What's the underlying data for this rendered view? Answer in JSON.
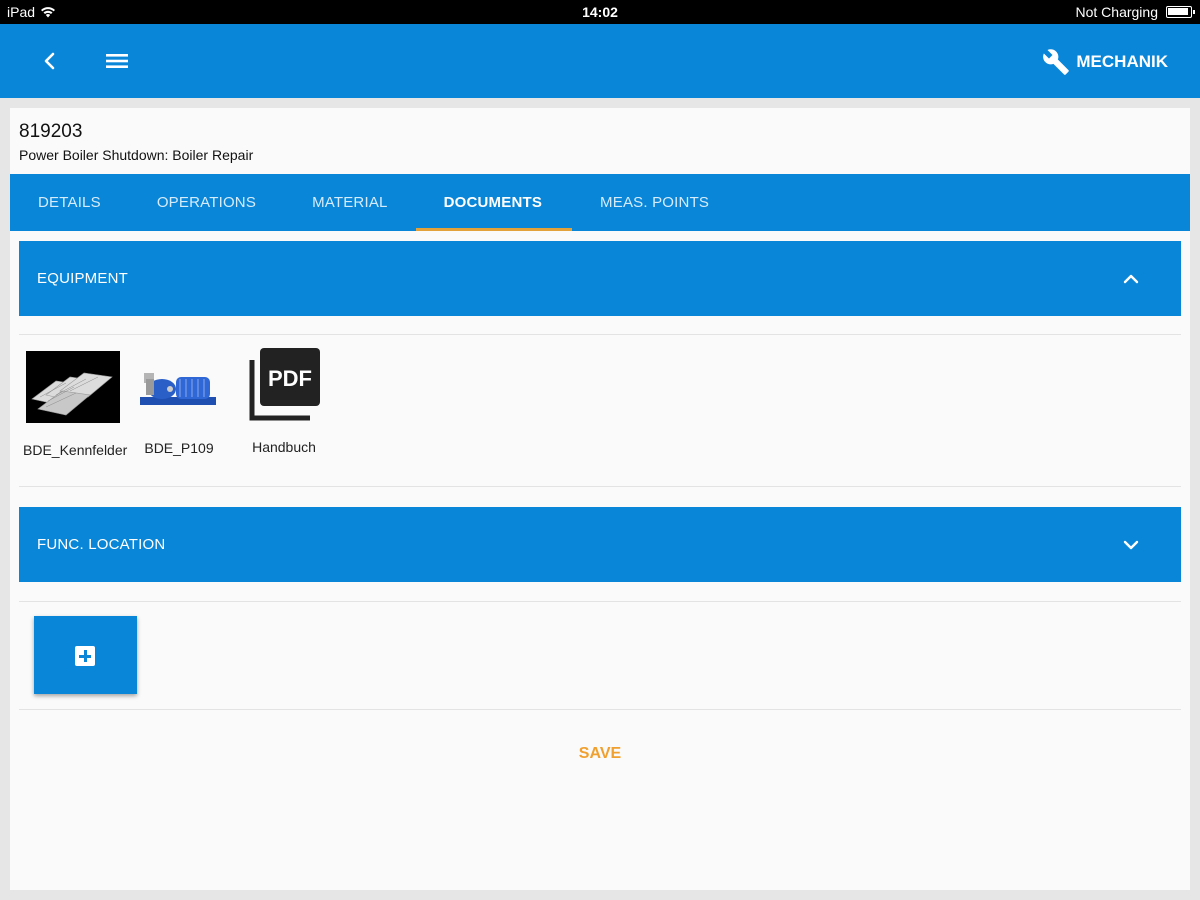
{
  "status_bar": {
    "device": "iPad",
    "time": "14:02",
    "charging": "Not Charging"
  },
  "app_bar": {
    "role_label": "MECHANIK",
    "icons": {
      "back": "chevron-left-icon",
      "menu": "hamburger-menu-icon",
      "role": "wrench-icon"
    }
  },
  "order": {
    "id": "819203",
    "description": "Power Boiler Shutdown: Boiler Repair"
  },
  "tabs": [
    {
      "label": "DETAILS",
      "active": false
    },
    {
      "label": "OPERATIONS",
      "active": false
    },
    {
      "label": "MATERIAL",
      "active": false
    },
    {
      "label": "DOCUMENTS",
      "active": true
    },
    {
      "label": "MEAS. POINTS",
      "active": false
    }
  ],
  "sections": {
    "equipment": {
      "title": "EQUIPMENT",
      "expanded": true,
      "documents": [
        {
          "label_line1": "BDE_Kennfelder",
          "label_line2": "",
          "label": "BDE_Kennfelder",
          "type": "image"
        },
        {
          "label": "BDE_P109",
          "type": "image"
        },
        {
          "label": "Handbuch",
          "type": "pdf",
          "icon_text": "PDF"
        }
      ]
    },
    "func_location": {
      "title": "FUNC. LOCATION",
      "expanded": false
    }
  },
  "actions": {
    "add": "plus-box-icon",
    "save_label": "SAVE"
  },
  "colors": {
    "primary": "#0a86d8",
    "tab_indicator": "#e4a33a",
    "save": "#f0a02e"
  }
}
